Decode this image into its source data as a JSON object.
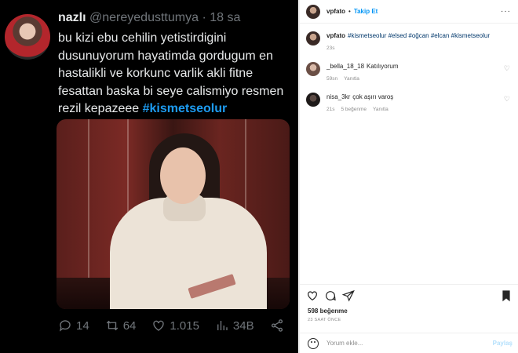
{
  "tweet": {
    "name": "nazlı",
    "handle": "@nereyedusttumya",
    "separator": "·",
    "time": "18 sa",
    "text_lines": [
      "bu kizi ebu cehilin yetistirdigini",
      "dusunuyorum hayatimda gordugum en",
      "hastalikli ve korkunc varlik akli fitne",
      "fesattan baska bi seye calismiyo resmen",
      "rezil kepazeee "
    ],
    "hashtag": "#kismetseolur",
    "replies": "14",
    "retweets": "64",
    "likes": "1.015",
    "views": "34B",
    "icons": [
      "reply-icon",
      "retweet-icon",
      "like-icon",
      "views-icon",
      "share-icon"
    ]
  },
  "instagram": {
    "username": "vpfato",
    "separator": "•",
    "follow_label": "Takip Et",
    "more_label": "···",
    "caption": {
      "username": "vpfato",
      "text": "#kismetseolur #elsed #oğcan #elcan #kismetseolur",
      "time": "23s"
    },
    "comments": [
      {
        "username": "_bella_18_18",
        "text": "Katılıyorum",
        "time": "59sn",
        "reply": "Yanıtla",
        "likes": ""
      },
      {
        "username": "nisa_3kr",
        "text": "çok aşırı varoş",
        "time": "21s",
        "likes": "5 beğenme",
        "reply": "Yanıtla"
      }
    ],
    "likes_count": "598 beğenme",
    "post_time": "23 SAAT ÖNCE",
    "comment_placeholder": "Yorum ekle...",
    "post_button": "Paylaş",
    "colors": {
      "link": "#0095f6",
      "muted": "#8e8e8e",
      "text": "#262626"
    }
  }
}
